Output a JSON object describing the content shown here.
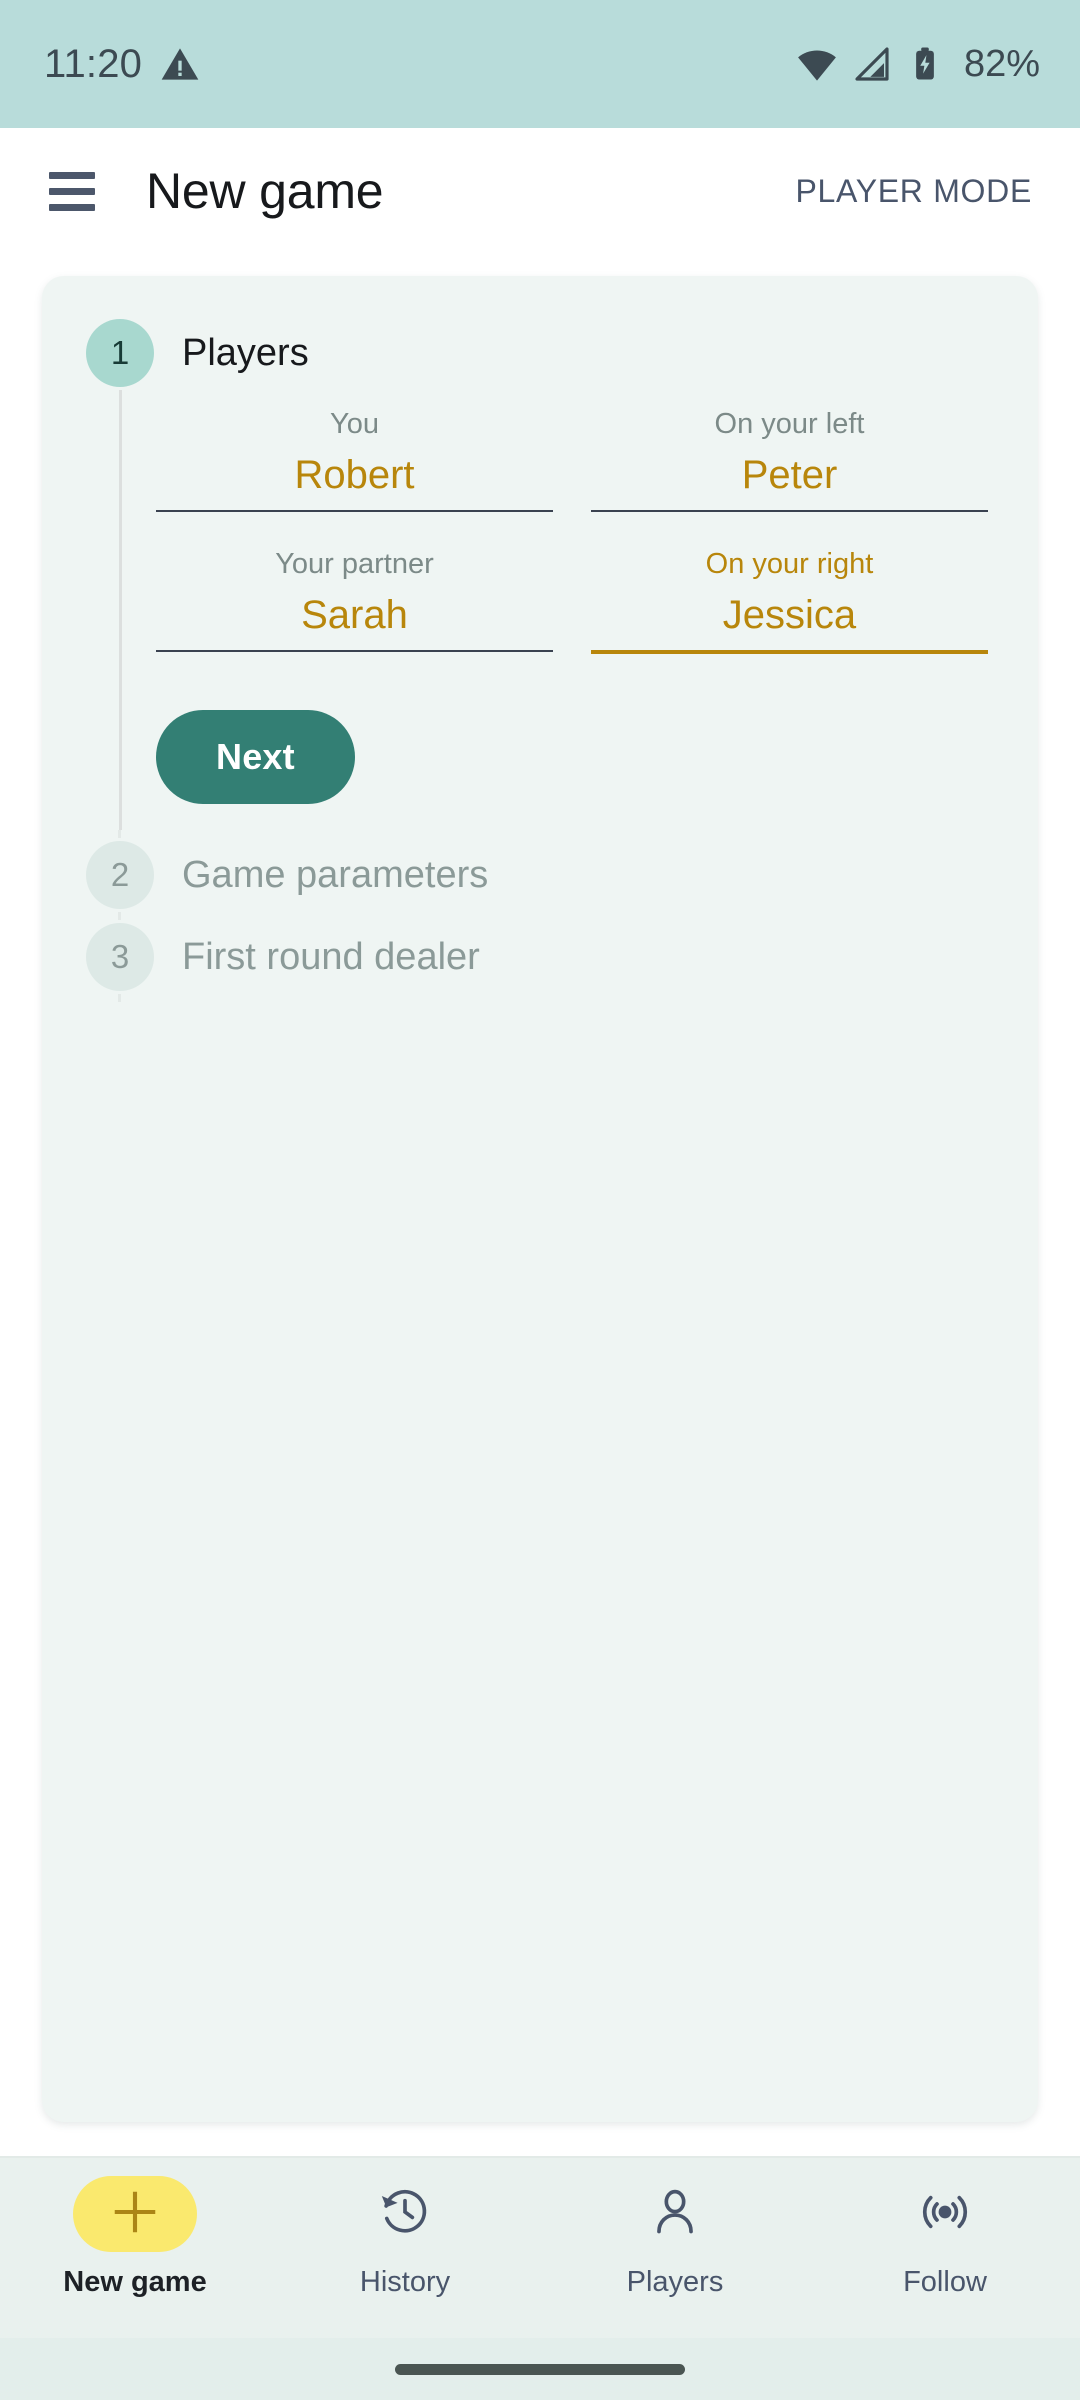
{
  "status_bar": {
    "time": "11:20",
    "warning_icon": "warning-triangle-icon",
    "wifi_icon": "wifi-icon",
    "signal_icon": "cell-signal-icon",
    "battery_icon": "battery-charging-icon",
    "battery_text": "82%",
    "background_color": "#b8dcda"
  },
  "app_bar": {
    "menu_icon": "hamburger-menu-icon",
    "title": "New game",
    "action_label": "PLAYER MODE"
  },
  "stepper": {
    "background_color": "#eff5f3",
    "steps": [
      {
        "number": "1",
        "label": "Players",
        "state": "active"
      },
      {
        "number": "2",
        "label": "Game parameters",
        "state": "inactive"
      },
      {
        "number": "3",
        "label": "First round dealer",
        "state": "inactive"
      }
    ]
  },
  "players_form": {
    "fields": [
      {
        "label": "You",
        "value": "Robert",
        "focused": false
      },
      {
        "label": "On your left",
        "value": "Peter",
        "focused": false
      },
      {
        "label": "Your partner",
        "value": "Sarah",
        "focused": false
      },
      {
        "label": "On your right",
        "value": "Jessica",
        "focused": true
      }
    ],
    "next_label": "Next",
    "next_color": "#337f74",
    "value_color": "#b8860b"
  },
  "bottom_nav": {
    "items": [
      {
        "label": "New game",
        "icon": "plus-icon",
        "active": true
      },
      {
        "label": "History",
        "icon": "history-icon",
        "active": false
      },
      {
        "label": "Players",
        "icon": "person-icon",
        "active": false
      },
      {
        "label": "Follow",
        "icon": "broadcast-icon",
        "active": false
      }
    ],
    "active_pill_color": "#fae96e"
  }
}
